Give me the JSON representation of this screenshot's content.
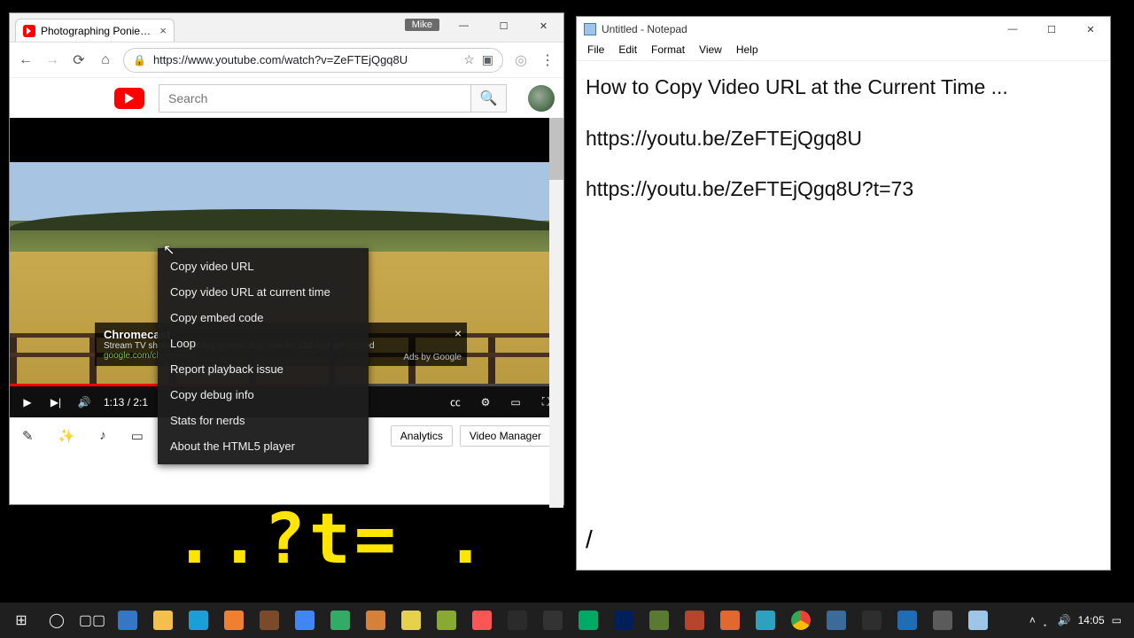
{
  "chrome": {
    "user_chip": "Mike",
    "tab_title": "Photographing Ponies fr",
    "url": "https://www.youtube.com/watch?v=ZeFTEjQgq8U",
    "yt_search_placeholder": "Search",
    "player_time": "1:13 / 2:1",
    "ad": {
      "title": "Chromecast",
      "line1": "Stream TV shows on the big screen. Buy now for £30 and get started",
      "site": "google.com/chromecast",
      "by": "Ads by Google"
    },
    "context_menu": [
      "Copy video URL",
      "Copy video URL at current time",
      "Copy embed code",
      "Loop",
      "Report playback issue",
      "Copy debug info",
      "Stats for nerds",
      "About the HTML5 player"
    ],
    "buttons": {
      "analytics": "Analytics",
      "video_manager": "Video Manager"
    }
  },
  "notepad": {
    "title": "Untitled - Notepad",
    "menu": [
      "File",
      "Edit",
      "Format",
      "View",
      "Help"
    ],
    "line1": "How to Copy Video URL at the Current Time ...",
    "line2": "https://youtu.be/ZeFTEjQgq8U",
    "line3": "https://youtu.be/ZeFTEjQgq8U?t=73",
    "slash": "/"
  },
  "overlay_text": "..?t= .",
  "taskbar": {
    "clock": "14:05"
  }
}
